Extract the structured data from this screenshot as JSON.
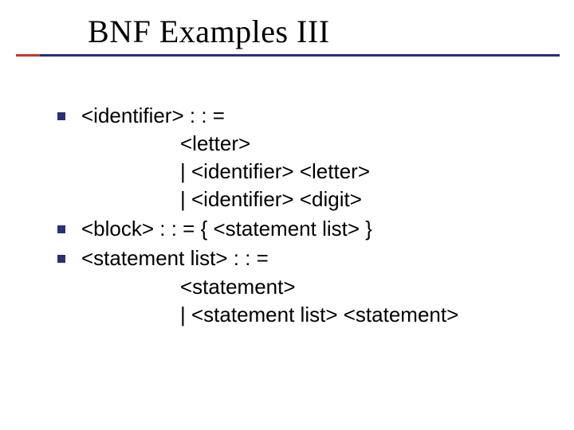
{
  "title": "BNF Examples III",
  "items": [
    {
      "head": "<identifier> : : =",
      "lines": [
        "<letter>",
        "|  <identifier> <letter>",
        "|  <identifier> <digit>"
      ]
    },
    {
      "head": "<block> : : = { <statement list> }",
      "lines": []
    },
    {
      "head": "<statement list> : : =",
      "lines": [
        "<statement>",
        "|  <statement list> <statement>"
      ]
    }
  ]
}
